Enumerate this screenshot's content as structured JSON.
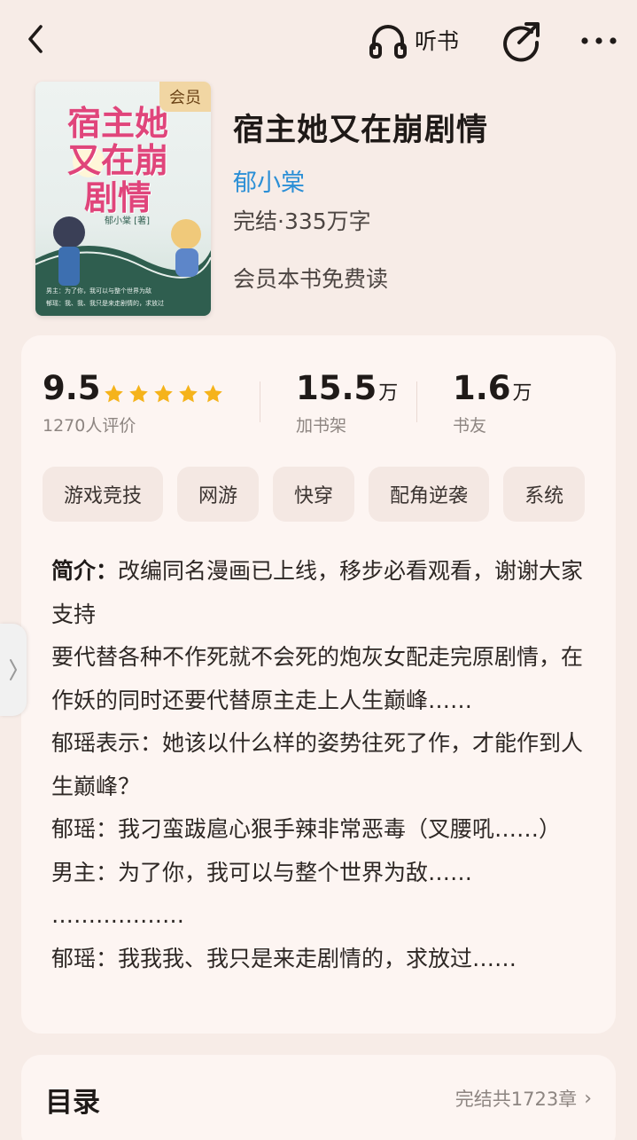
{
  "topbar": {
    "back_icon": "chevron-left-icon",
    "listen_label": "听书",
    "listen_icon": "headphones-icon",
    "share_icon": "share-arrow-icon",
    "more_icon": "more-dots-icon"
  },
  "book": {
    "cover_badge": "会员",
    "cover_title": "宿主她又在崩剧情",
    "cover_author": "郁小棠 [著]",
    "title": "宿主她又在崩剧情",
    "author": "郁小棠",
    "status": "完结·335万字",
    "vip_read": "会员本书免费读"
  },
  "stats": {
    "rating": "9.5",
    "rating_stars": 5,
    "rating_count": "1270人评价",
    "shelf_num": "15.5",
    "shelf_unit": "万",
    "shelf_label": "加书架",
    "fans_num": "1.6",
    "fans_unit": "万",
    "fans_label": "书友"
  },
  "tags": [
    "游戏竞技",
    "网游",
    "快穿",
    "配角逆袭",
    "系统"
  ],
  "intro": {
    "label": "简介：",
    "first": "改编同名漫画已上线，移步必看观看，谢谢大家支持",
    "lines": [
      "要代替各种不作死就不会死的炮灰女配走完原剧情，在作妖的同时还要代替原主走上人生巅峰……",
      "郁瑶表示：她该以什么样的姿势往死了作，才能作到人生巅峰？",
      "郁瑶：我刁蛮跋扈心狠手辣非常恶毒（叉腰吼……）",
      "男主：为了你，我可以与整个世界为敌……",
      "………………",
      "郁瑶：我我我、我只是来走剧情的，求放过……"
    ]
  },
  "toc": {
    "title": "目录",
    "meta": "完结共1723章",
    "chevron": "›"
  },
  "colors": {
    "background": "#f7ece7",
    "card": "#fdf5f2",
    "author_link": "#2b8fd6",
    "star": "#f5b31b"
  }
}
